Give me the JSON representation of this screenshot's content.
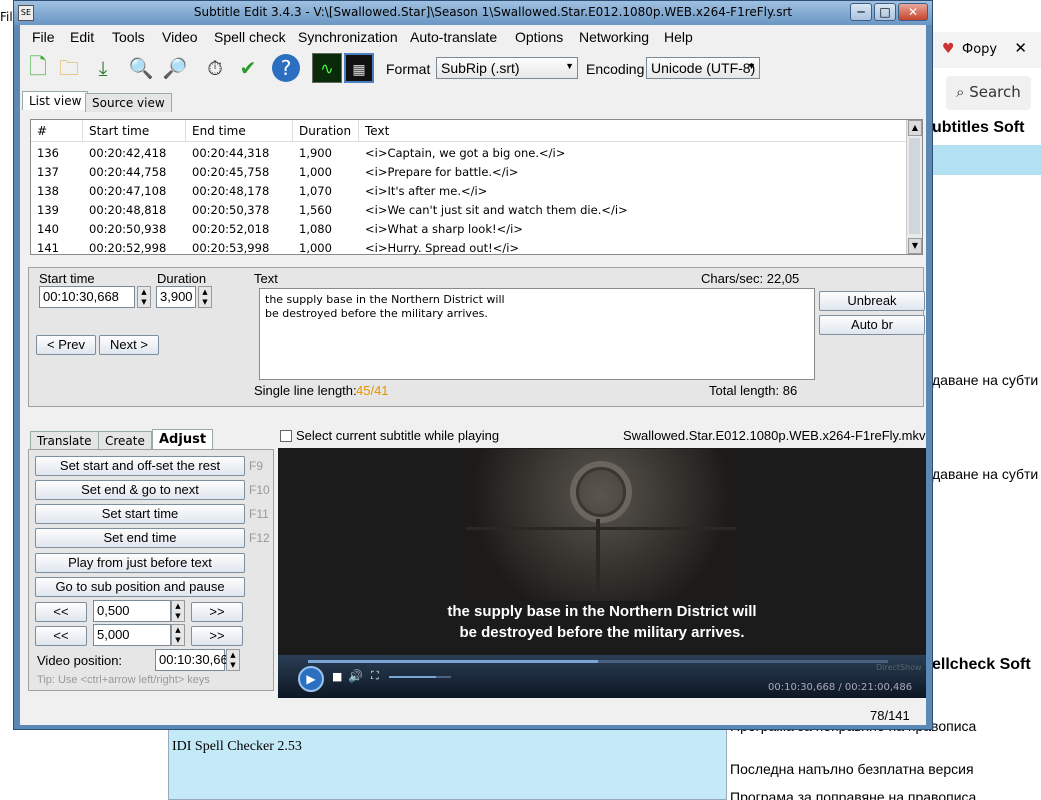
{
  "background": {
    "tab_label": "Фору",
    "search_label": "Search",
    "left_fragment": "File",
    "heading1": "ubtitles Soft",
    "line1": "даване на субти",
    "line2": "даване на субти",
    "heading2": "ellcheck Soft",
    "row_cell": "IDI Spell Checker 2.53",
    "row_text1": "Програма за поправяне на правописа",
    "row_text2": "Последна напълно безплатна версия",
    "row_text3": "Програма за поправяне на правописа"
  },
  "window": {
    "title": "Subtitle Edit 3.4.3 - V:\\[Swallowed.Star]\\Season 1\\Swallowed.Star.E012.1080p.WEB.x264-F1reFly.srt",
    "minimize": "─",
    "maximize": "□",
    "close": "✕"
  },
  "menu": [
    "File",
    "Edit",
    "Tools",
    "Video",
    "Spell check",
    "Synchronization",
    "Auto-translate",
    "Options",
    "Networking",
    "Help"
  ],
  "toolbar": {
    "format_label": "Format",
    "format_value": "SubRip (.srt)",
    "encoding_label": "Encoding",
    "encoding_value": "Unicode (UTF-8)"
  },
  "view_tabs": {
    "list": "List view",
    "source": "Source view"
  },
  "list": {
    "headers": [
      "#",
      "Start time",
      "End time",
      "Duration",
      "Text"
    ],
    "rows": [
      {
        "n": "136",
        "start": "00:20:42,418",
        "end": "00:20:44,318",
        "dur": "1,900",
        "text": "<i>Captain, we got a big one.</i>"
      },
      {
        "n": "137",
        "start": "00:20:44,758",
        "end": "00:20:45,758",
        "dur": "1,000",
        "text": "<i>Prepare for battle.</i>"
      },
      {
        "n": "138",
        "start": "00:20:47,108",
        "end": "00:20:48,178",
        "dur": "1,070",
        "text": "<i>It's after me.</i>"
      },
      {
        "n": "139",
        "start": "00:20:48,818",
        "end": "00:20:50,378",
        "dur": "1,560",
        "text": "<i>We can't just sit and watch them die.</i>"
      },
      {
        "n": "140",
        "start": "00:20:50,938",
        "end": "00:20:52,018",
        "dur": "1,080",
        "text": "<i>What a sharp look!</i>"
      },
      {
        "n": "141",
        "start": "00:20:52,998",
        "end": "00:20:53,998",
        "dur": "1,000",
        "text": "<i>Hurry. Spread out!</i>"
      }
    ]
  },
  "edit": {
    "start_label": "Start time",
    "start_value": "00:10:30,668",
    "duration_label": "Duration",
    "duration_value": "3,900",
    "text_label": "Text",
    "chars_sec": "Chars/sec: 22,05",
    "text_line1": "the supply base in the Northern District will",
    "text_line2": "be destroyed before the military arrives.",
    "prev": "< Prev",
    "next": "Next >",
    "unbreak": "Unbreak",
    "autobr": "Auto br",
    "single_line_label": "Single line length:",
    "single_line_value": "45/41",
    "total_length": "Total length: 86"
  },
  "lower_tabs": {
    "translate": "Translate",
    "create": "Create",
    "adjust": "Adjust"
  },
  "adjust": {
    "b1": "Set start and off-set the rest",
    "k1": "F9",
    "b2": "Set end & go to next",
    "k2": "F10",
    "b3": "Set start time",
    "k3": "F11",
    "b4": "Set end time",
    "k4": "F12",
    "b5": "Play from just before text",
    "b6": "Go to sub position and pause",
    "back": "<<",
    "fwd": ">>",
    "step1": "0,500",
    "step2": "5,000",
    "video_pos_label": "Video position:",
    "video_pos_value": "00:10:30,668",
    "tip": "Tip: Use <ctrl+arrow left/right> keys"
  },
  "video": {
    "select_label": "Select current subtitle while playing",
    "filename": "Swallowed.Star.E012.1080p.WEB.x264-F1reFly.mkv",
    "sub_line1": "the supply base in the Northern District will",
    "sub_line2": "be destroyed before the military arrives.",
    "watermark": "DirectShow",
    "time": "00:10:30,668 / 00:21:00,486",
    "progress": 0.5,
    "volume": 0.75
  },
  "status": {
    "position": "78/141"
  },
  "colors": {
    "warning": "#e69500",
    "title_bar": "#6a96c4",
    "video_bg": "#1b1b1b"
  }
}
